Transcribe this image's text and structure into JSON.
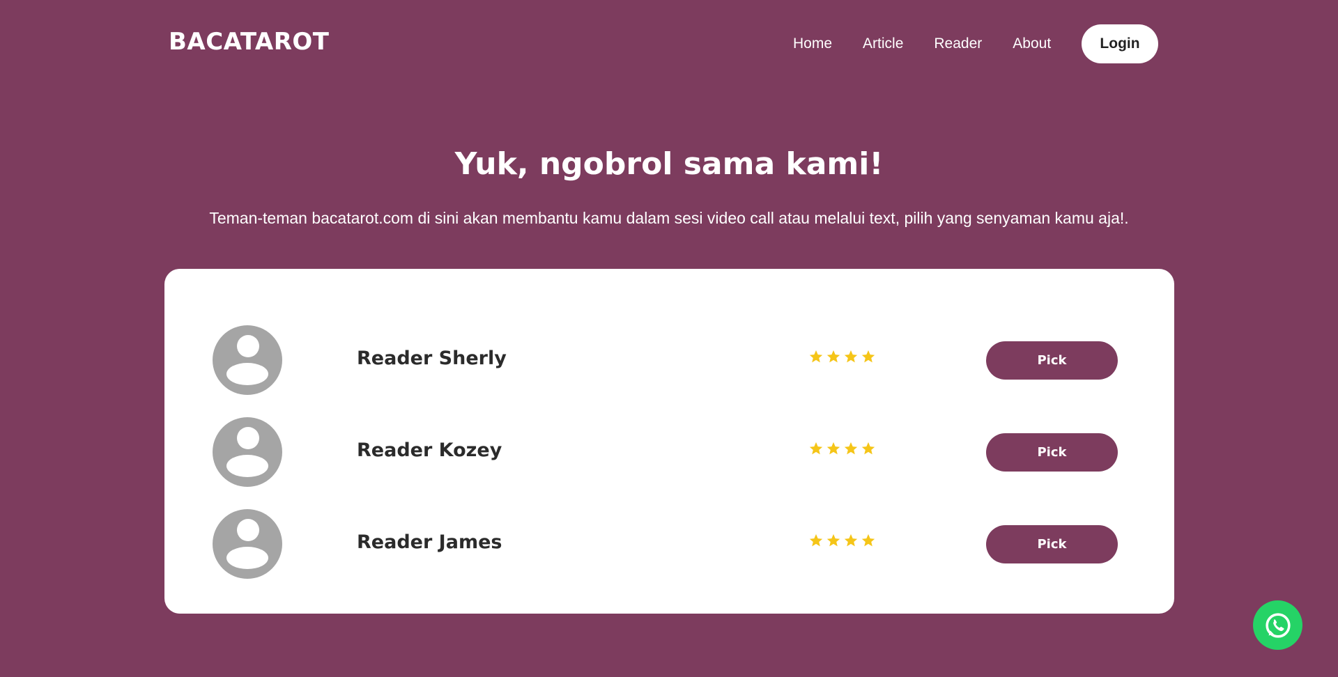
{
  "brand": "BACATAROT",
  "nav": {
    "links": [
      "Home",
      "Article",
      "Reader",
      "About"
    ],
    "login_label": "Login"
  },
  "hero": {
    "title": "Yuk, ngobrol sama kami!",
    "subtitle": "Teman-teman bacatarot.com di sini akan membantu kamu dalam sesi video call atau melalui text, pilih yang senyaman kamu aja!."
  },
  "readers": [
    {
      "name": "Reader Sherly",
      "rating": 4,
      "pick_label": "Pick"
    },
    {
      "name": "Reader Kozey",
      "rating": 4,
      "pick_label": "Pick"
    },
    {
      "name": "Reader James",
      "rating": 4,
      "pick_label": "Pick"
    }
  ],
  "colors": {
    "background": "#7d3c5e",
    "card": "#ffffff",
    "star": "#f5c518",
    "whatsapp": "#25d366",
    "avatar": "#a5a5a5"
  },
  "icons": {
    "floating_button": "whatsapp-icon",
    "avatar": "user-avatar-icon",
    "rating": "star-icon"
  }
}
